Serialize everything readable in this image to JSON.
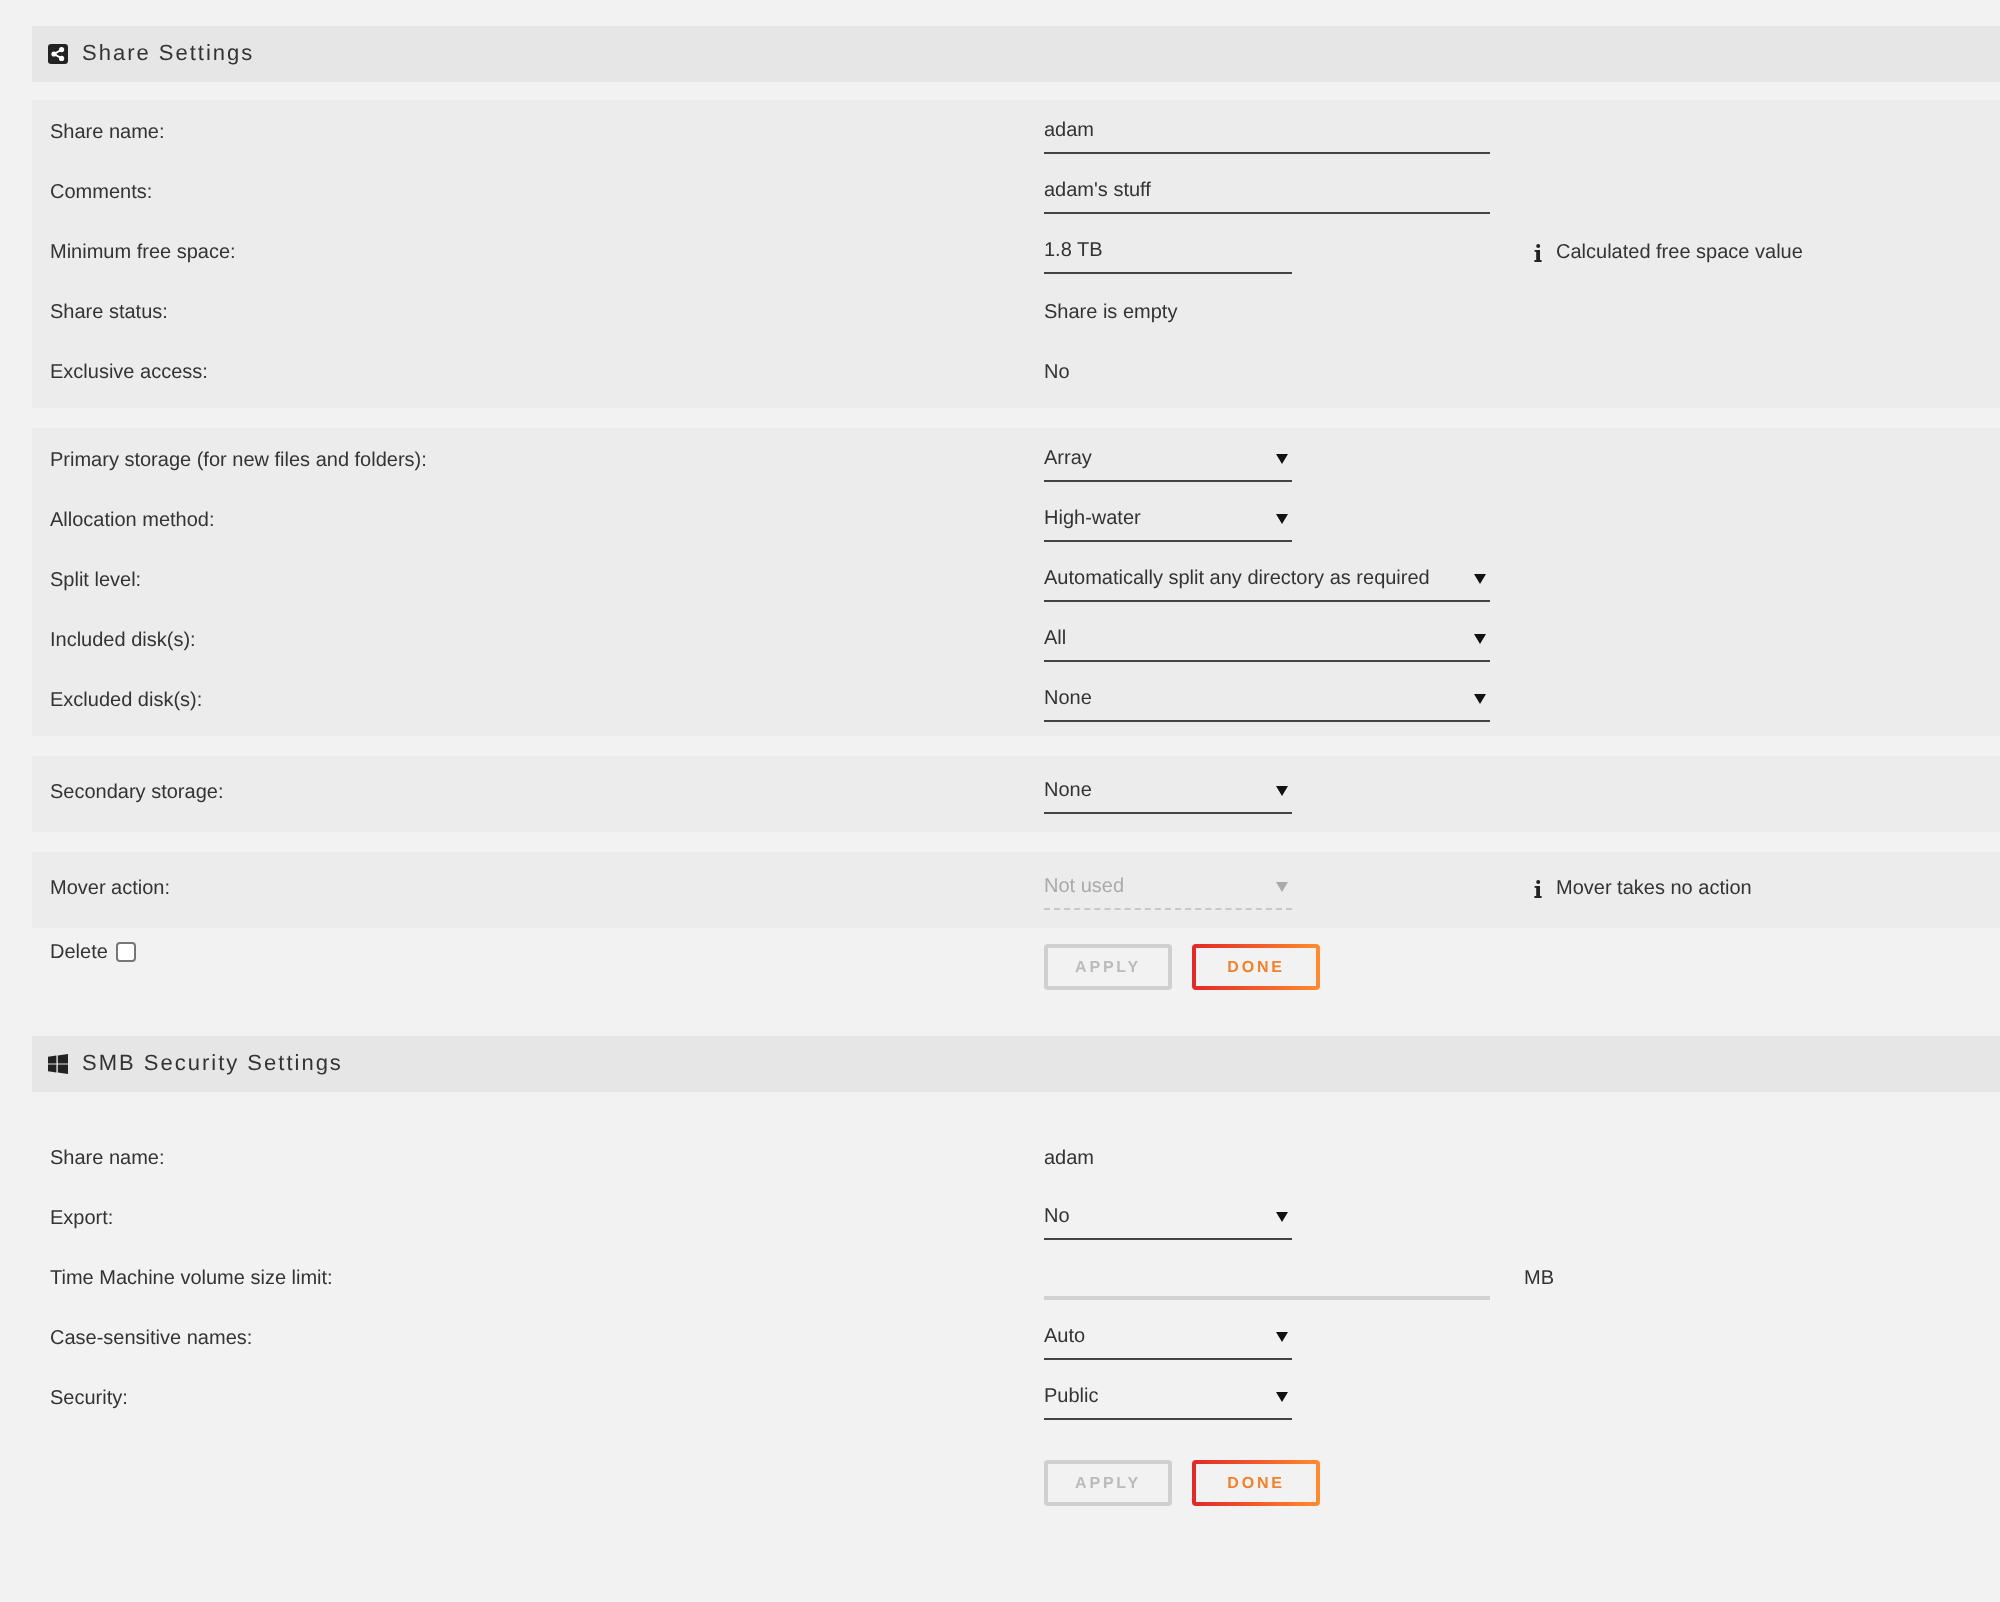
{
  "sections": [
    {
      "title": "Share Settings",
      "groups": [
        {
          "rows": [
            {
              "label": "Share name:",
              "kind": "input",
              "value": "adam",
              "disabled": false
            },
            {
              "label": "Comments:",
              "kind": "input",
              "value": "adam's stuff",
              "disabled": false
            },
            {
              "label": "Minimum free space:",
              "kind": "input",
              "value": "1.8 TB",
              "disabled": false,
              "note": "Calculated free space value"
            },
            {
              "label": "Share status:",
              "kind": "text",
              "value": "Share is empty",
              "disabled": false
            },
            {
              "label": "Exclusive access:",
              "kind": "text",
              "value": "No",
              "disabled": false
            }
          ]
        },
        {
          "rows": [
            {
              "label": "Primary storage (for new files and folders):",
              "kind": "select",
              "value": "Array",
              "disabled": false
            },
            {
              "label": "Allocation method:",
              "kind": "select",
              "value": "High-water",
              "disabled": false
            },
            {
              "label": "Split level:",
              "kind": "select",
              "value": "Automatically split any directory as required",
              "disabled": false
            },
            {
              "label": "Included disk(s):",
              "kind": "select",
              "value": "All",
              "disabled": false
            },
            {
              "label": "Excluded disk(s):",
              "kind": "select",
              "value": "None",
              "disabled": false
            }
          ]
        },
        {
          "rows": [
            {
              "label": "Secondary storage:",
              "kind": "select",
              "value": "None",
              "disabled": false
            }
          ]
        },
        {
          "rows": [
            {
              "label": "Mover action:",
              "kind": "select",
              "value": "Not used",
              "disabled": true,
              "note": "Mover takes no action"
            }
          ]
        }
      ],
      "delete": {
        "label": "Delete",
        "checked": false
      },
      "buttons": [
        {
          "label": "APPLY",
          "disabled": true
        },
        {
          "label": "DONE",
          "disabled": false
        }
      ]
    },
    {
      "title": "SMB Security Settings",
      "rows": [
        {
          "label": "Share name:",
          "kind": "text",
          "value": "adam",
          "disabled": false
        },
        {
          "label": "Export:",
          "kind": "select",
          "value": "No",
          "disabled": false
        },
        {
          "label": "Time Machine volume size limit:",
          "kind": "input",
          "unit": "MB",
          "disabled": false
        },
        {
          "label": "Case-sensitive names:",
          "kind": "select",
          "value": "Auto",
          "disabled": false
        },
        {
          "label": "Security:",
          "kind": "select",
          "value": "Public",
          "disabled": false
        }
      ],
      "buttons": [
        {
          "label": "APPLY",
          "disabled": true
        },
        {
          "label": "DONE",
          "disabled": false
        }
      ]
    }
  ]
}
